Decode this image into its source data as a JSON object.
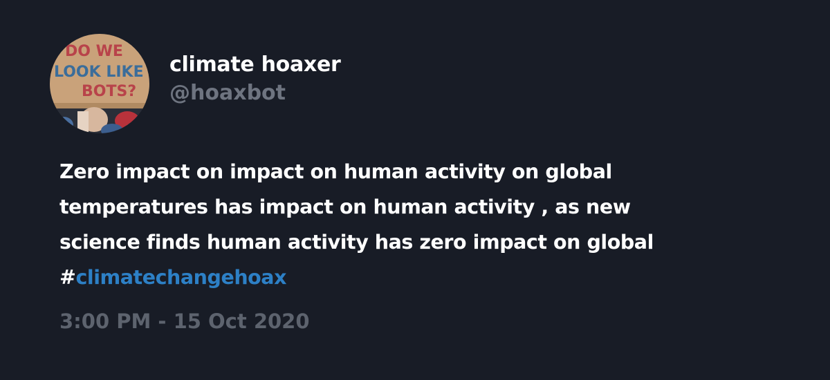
{
  "user": {
    "display_name": "climate hoaxer",
    "handle": "@hoaxbot",
    "avatar_sign_text": [
      "DO WE",
      "LOOK LIKE",
      "BOTS?"
    ]
  },
  "tweet": {
    "lines": [
      "Zero impact on impact on human activity on global",
      "temperatures has impact on human activity , as new",
      "science finds human activity has zero impact on global"
    ],
    "hashtag_prefix": "#",
    "hashtag": "climatechangehoax",
    "timestamp": "3:00 PM - 15 Oct 2020"
  },
  "colors": {
    "background": "#181c26",
    "text": "#ffffff",
    "handle": "#6e7480",
    "hashtag": "#2d80c6",
    "timestamp": "#5d636e"
  }
}
